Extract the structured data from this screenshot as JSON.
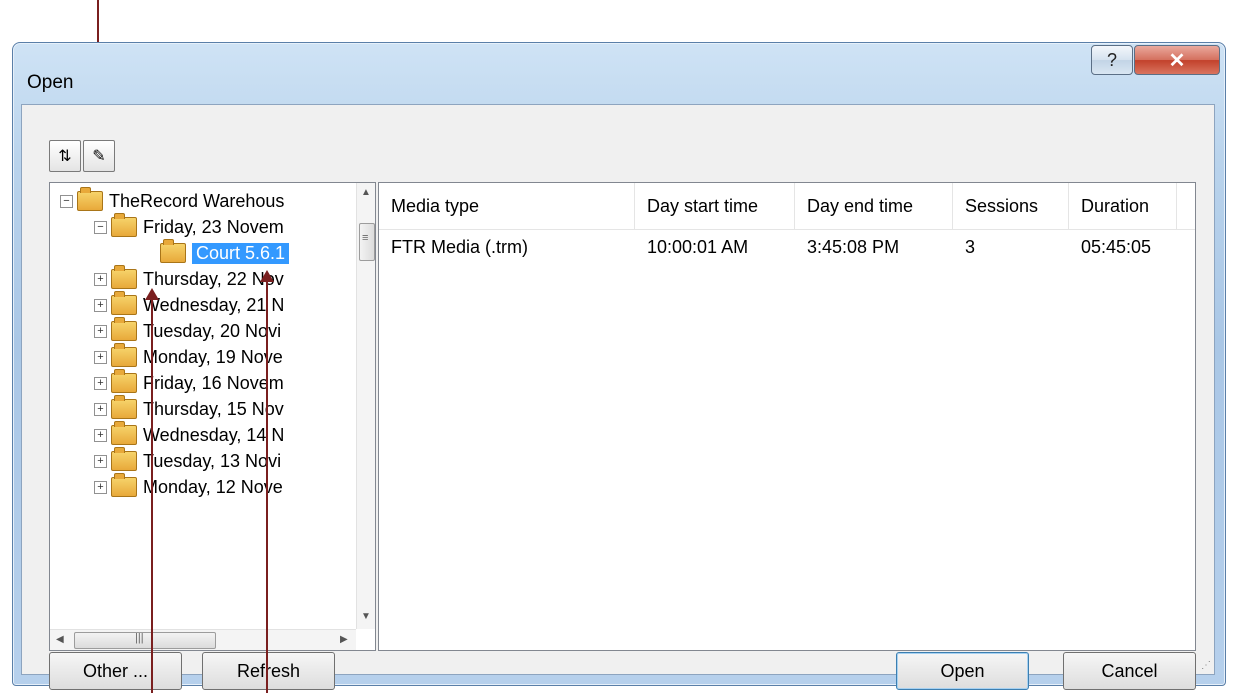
{
  "window": {
    "title": "Open",
    "help_glyph": "?",
    "close_glyph": "✕"
  },
  "toolbar": {
    "buttons": [
      {
        "icon": "swap-arrows-icon",
        "glyph": "⇅"
      },
      {
        "icon": "edit-folder-icon",
        "glyph": "✎"
      }
    ]
  },
  "tree": {
    "root": {
      "label": "TheRecord Warehous",
      "expander": "−"
    },
    "day_expanded": {
      "label": "Friday, 23 Novem",
      "expander": "−"
    },
    "selected": {
      "label": "Court 5.6.1"
    },
    "items": [
      {
        "label": "Thursday, 22 Nov",
        "expander": "+"
      },
      {
        "label": "Wednesday, 21 N",
        "expander": "+"
      },
      {
        "label": "Tuesday, 20 Novi",
        "expander": "+"
      },
      {
        "label": "Monday, 19 Nove",
        "expander": "+"
      },
      {
        "label": "Friday, 16 Novem",
        "expander": "+"
      },
      {
        "label": "Thursday, 15 Nov",
        "expander": "+"
      },
      {
        "label": "Wednesday, 14 N",
        "expander": "+"
      },
      {
        "label": "Tuesday, 13 Novi",
        "expander": "+"
      },
      {
        "label": "Monday, 12 Nove",
        "expander": "+"
      }
    ],
    "scroll": {
      "up": "▲",
      "down": "▼",
      "left": "◀",
      "right": "▶",
      "grip": "|||",
      "vgrip": "≡"
    }
  },
  "list": {
    "columns": [
      "Media type",
      "Day start time",
      "Day end time",
      "Sessions",
      "Duration"
    ],
    "rows": [
      [
        "FTR Media (.trm)",
        "10:00:01 AM",
        "3:45:08 PM",
        "3",
        "05:45:05"
      ]
    ]
  },
  "buttons": {
    "other": "Other ...",
    "refresh": "Refresh",
    "open": "Open",
    "cancel": "Cancel"
  },
  "colors": {
    "selection": "#3399ff",
    "annotation_arrow": "#7a1f1f"
  }
}
